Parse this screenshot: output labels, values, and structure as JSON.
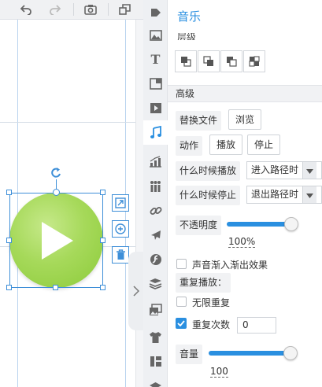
{
  "panel": {
    "title": "音乐",
    "hidden_label": "层级",
    "section_advanced": "高级",
    "replace_file_label": "替换文件",
    "browse_button": "浏览",
    "action_label": "动作",
    "play_button": "播放",
    "stop_button": "停止",
    "when_play_label": "什么时候播放",
    "when_play_value": "进入路径时",
    "when_stop_label": "什么时候停止",
    "when_stop_value": "退出路径时",
    "opacity_label": "不透明度",
    "opacity_value": "100%",
    "opacity_level": 1.0,
    "fade_label": "声音渐入渐出效果",
    "fade_checked": false,
    "repeat_title": "重复播放：",
    "infinite_label": "无限重复",
    "infinite_checked": false,
    "repeat_count_label": "重复次数",
    "repeat_count_checked": true,
    "repeat_count_value": "0",
    "volume_label": "音量",
    "volume_value": "100",
    "volume_level": 1.0
  },
  "toolbar": {
    "icons": [
      "undo-icon",
      "redo-icon",
      "camera-icon",
      "copy-window-icon"
    ]
  },
  "rail": {
    "icons": [
      "shape-icon",
      "image-icon",
      "text-icon",
      "layout-icon",
      "video-icon",
      "music-icon",
      "chart-icon",
      "people-icon",
      "link-icon",
      "plane-icon",
      "flash-icon",
      "layers-icon",
      "gallery-icon",
      "shirt-icon",
      "panel-icon",
      "stack-icon"
    ],
    "active": "music-icon"
  },
  "colors": {
    "accent": "#2a8fe0",
    "selection": "#3e8fd8",
    "play_green": "#9bd24c"
  }
}
